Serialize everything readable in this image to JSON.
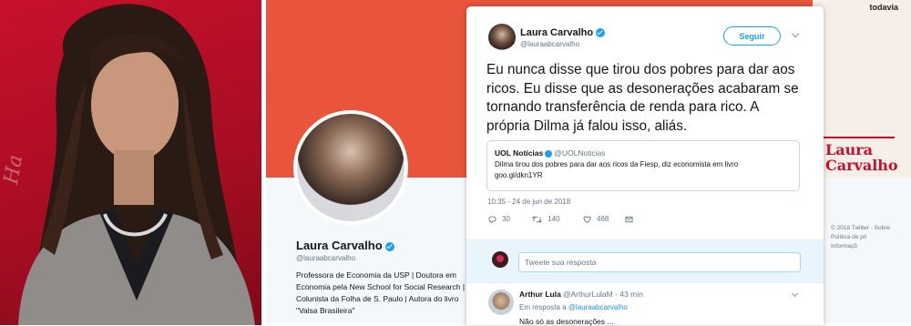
{
  "photo": {
    "watermark": "Ha"
  },
  "background_profile": {
    "brand": "todavia",
    "banner_title_line1": "Laura",
    "banner_title_line2": "Carvalho",
    "name": "Laura Carvalho",
    "handle": "@lauraabcarvalho",
    "bio": "Professora de Economia da USP | Doutora em Economia pela New School for Social Research | Colunista da Folha de S. Paulo | Autora do livro \"Valsa Brasileira\"",
    "footer_line1": "© 2018 Twitter · Sobre",
    "footer_line2": "Política de pri",
    "footer_line3": "Informaçõ"
  },
  "tweet": {
    "author_name": "Laura Carvalho",
    "author_handle": "@lauraabcarvalho",
    "follow_label": "Seguir",
    "text": "Eu nunca disse que tirou dos pobres para dar aos ricos. Eu disse que as desonerações acabaram se tornando transferência de renda para rico. A própria Dilma já falou isso, aliás.",
    "quoted": {
      "name": "UOL Notícias",
      "handle": "@UOLNoticias",
      "text": "Dilma tirou dos pobres para dar aos ricos da Fiesp, diz economista em livro",
      "link": "goo.gl/dkn1YR"
    },
    "timestamp": "10:35 - 24 de jun de 2018",
    "replies": "30",
    "retweets": "140",
    "likes": "468",
    "reply_placeholder": "Tweete sua resposta"
  },
  "reply": {
    "name": "Arthur Lula",
    "handle_time": "@ArthurLulaM · 43 min",
    "replying_prefix": "Em resposta a",
    "replying_to": "@lauraabcarvalho",
    "text": "Não só as desonerações ..."
  },
  "colors": {
    "accent": "#1da1f2",
    "banner_orange": "#e8553a",
    "photo_red": "#c8102e",
    "like_red": "#e0245e"
  },
  "icons": [
    "reply-icon",
    "retweet-icon",
    "like-icon",
    "dm-icon",
    "verified-icon",
    "chevron-down-icon"
  ]
}
